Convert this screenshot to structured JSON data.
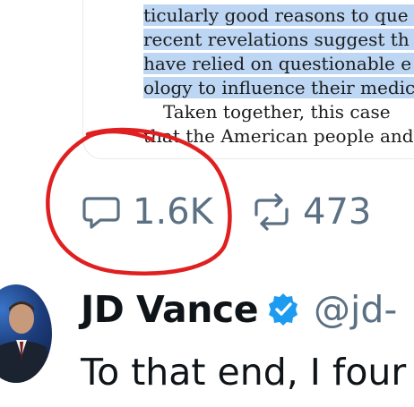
{
  "document": {
    "lines": [
      "ticularly good reasons to que",
      "recent revelations suggest th",
      "have relied on questionable e",
      "ology to influence their medic",
      "Taken together, this case",
      "that the American people and"
    ]
  },
  "actions": {
    "reply_count": "1.6K",
    "retweet_count": "473"
  },
  "tweet": {
    "author_name": "JD Vance",
    "handle": "@jd-",
    "text": "To that end, I four"
  },
  "colors": {
    "text_primary": "#0f1419",
    "text_secondary": "#5b7083",
    "verified_badge": "#1d9bf0",
    "highlight": "#bcd6f4",
    "annotation": "#e02020"
  },
  "icons": {
    "reply": "speech-bubble-icon",
    "retweet": "retweet-arrows-icon",
    "verified": "verified-badge-icon"
  }
}
